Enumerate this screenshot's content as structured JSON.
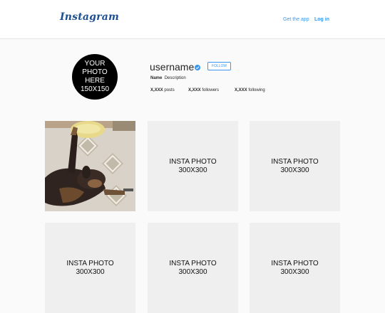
{
  "header": {
    "logo_text": "Instagram",
    "get_app_label": "Get the app",
    "login_label": "Log in"
  },
  "profile": {
    "avatar_text": "YOUR\nPHOTO\nHERE\n150X150",
    "username": "username",
    "verified_icon": "verified-check-icon",
    "follow_label": "FOLLOW",
    "name": "Name",
    "description": "Description",
    "posts_count": "X,XXX",
    "posts_label": " posts",
    "followers_count": "X,XXX",
    "followers_label": " followers",
    "following_count": "X,XXX",
    "following_label": " following"
  },
  "grid": {
    "first_photo": "dog lying on patterned rug",
    "placeholder_text": "INSTA PHOTO\n300X300"
  },
  "colors": {
    "accent": "#3897f0",
    "logo": "#1d4f91",
    "placeholder": "#efefef"
  }
}
